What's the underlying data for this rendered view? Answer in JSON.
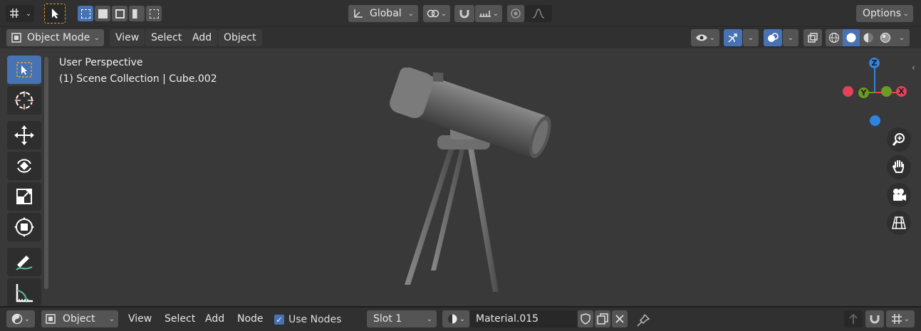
{
  "topbar": {
    "transform_orientation": "Global",
    "options_label": "Options"
  },
  "header": {
    "mode_label": "Object Mode",
    "menus": [
      "View",
      "Select",
      "Add",
      "Object"
    ]
  },
  "viewport": {
    "perspective_label": "User Perspective",
    "collection_label": "(1) Scene Collection | Cube.002",
    "gizmo": {
      "z": "Z",
      "y": "Y",
      "x": "X"
    }
  },
  "bottom": {
    "type_label": "Object",
    "menus": [
      "View",
      "Select",
      "Add",
      "Node"
    ],
    "use_nodes_label": "Use Nodes",
    "use_nodes_checked": true,
    "slot_label": "Slot 1",
    "material_name": "Material.015"
  },
  "colors": {
    "accent": "#4772b3",
    "panel": "#303030",
    "viewport": "#393939",
    "axis_x": "#e34257",
    "axis_y": "#6c9a22",
    "axis_z": "#2f84e0"
  }
}
